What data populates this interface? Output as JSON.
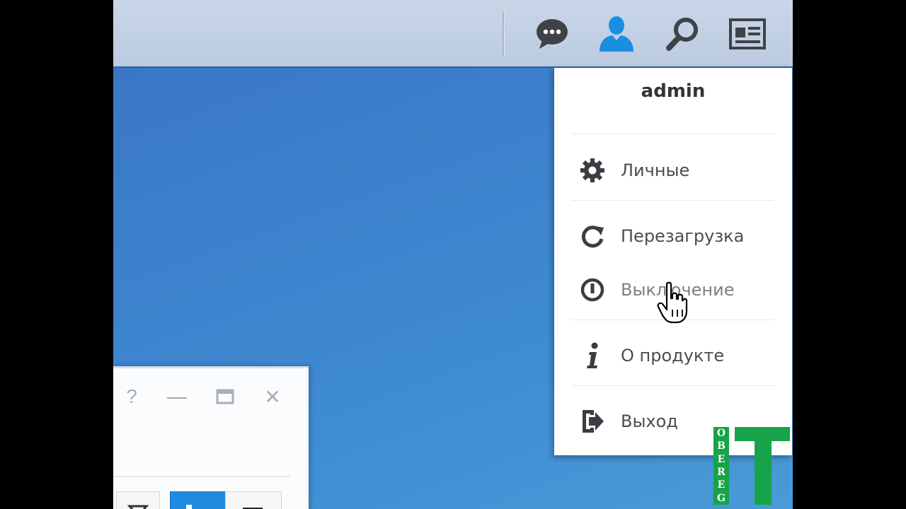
{
  "taskbar": {
    "icons": [
      "chat-icon",
      "user-icon",
      "search-icon",
      "widgets-icon"
    ],
    "user_icon_color": "#1a8ee0"
  },
  "user_menu": {
    "username": "admin",
    "items": [
      {
        "label": "Личные",
        "icon": "gear-icon"
      },
      {
        "label": "Перезагрузка",
        "icon": "restart-icon"
      },
      {
        "label": "Выключение",
        "icon": "power-icon"
      },
      {
        "label": "О продукте",
        "icon": "info-icon"
      },
      {
        "label": "Выход",
        "icon": "logout-icon"
      }
    ]
  },
  "window": {
    "controls": {
      "help": "?",
      "minimize": "—",
      "maximize": "▭",
      "close": "✕"
    }
  },
  "watermark": {
    "letters": [
      "O",
      "B",
      "E",
      "R",
      "E",
      "G"
    ],
    "big_letter": "T",
    "color": "#17a349"
  },
  "colors": {
    "desktop": "#3c82cc",
    "taskbar": "#c4d2e6"
  }
}
